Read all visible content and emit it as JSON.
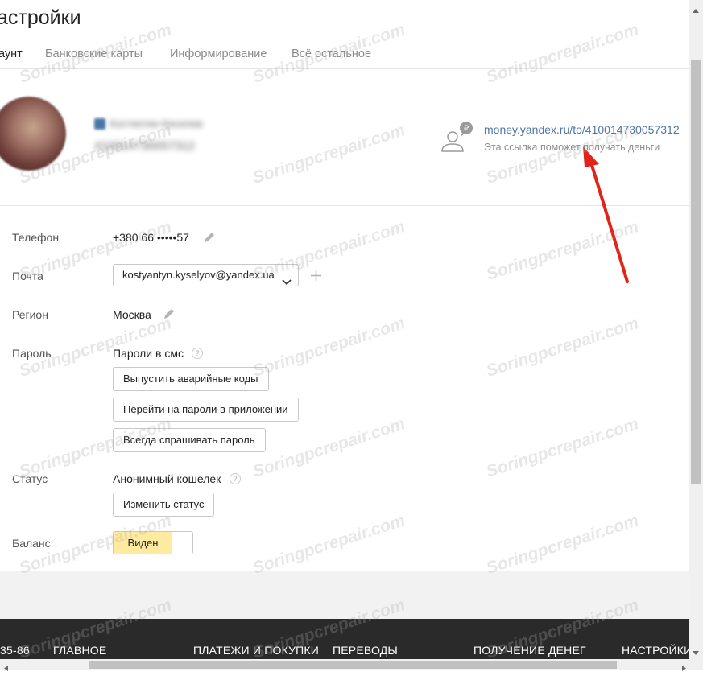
{
  "page": {
    "title": "астройки"
  },
  "tabs": [
    {
      "label": "аунт"
    },
    {
      "label": "Банковские карты"
    },
    {
      "label": "Информирование"
    },
    {
      "label": "Всё остальное"
    }
  ],
  "profile": {
    "name": "Костянтин Киселев",
    "account_number": "410014730057312"
  },
  "money_link": {
    "url": "money.yandex.ru/to/410014730057312",
    "hint": "Эта ссылка поможет получать деньги"
  },
  "fields": {
    "phone": {
      "label": "Телефон",
      "value": "+380 66 •••••57"
    },
    "email": {
      "label": "Почта",
      "value": "kostyantyn.kyselyov@yandex.ua"
    },
    "region": {
      "label": "Регион",
      "value": "Москва"
    },
    "password": {
      "label": "Пароль",
      "value": "Пароли в смс",
      "buttons": [
        "Выпустить аварийные коды",
        "Перейти на пароли в приложении",
        "Всегда спрашивать пароль"
      ]
    },
    "status": {
      "label": "Статус",
      "value": "Анонимный кошелек",
      "button": "Изменить статус"
    },
    "balance": {
      "label": "Баланс",
      "toggle": "Виден"
    }
  },
  "help_glyph": "?",
  "footer": {
    "items": [
      "35-86",
      "ГЛАВНОЕ",
      "ПЛАТЕЖИ И ПОКУПКИ",
      "ПЕРЕВОДЫ",
      "ПОЛУЧЕНИЕ ДЕНЕГ",
      "НАСТРОЙКИ"
    ]
  },
  "watermark": "Soringpcrepair.com",
  "colors": {
    "link": "#4f76a9",
    "arrow": "#e2231a",
    "toggle_on": "#ffeba0",
    "footer": "#2a2a2a"
  }
}
